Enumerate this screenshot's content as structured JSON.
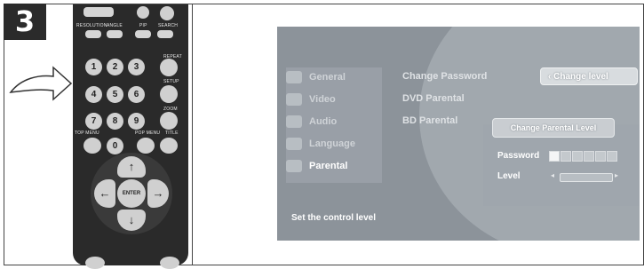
{
  "step": {
    "number": "3"
  },
  "remote": {
    "labels": {
      "resolution": "RESOLUTION",
      "angle": "ANGLE",
      "pip": "PIP",
      "search": "SEARCH",
      "repeat": "REPEAT",
      "setup": "SETUP",
      "zoom": "ZOOM",
      "top_menu": "TOP MENU",
      "pop_menu": "POP MENU",
      "title": "TITLE",
      "enter": "ENTER"
    },
    "numbers": [
      "1",
      "2",
      "3",
      "4",
      "5",
      "6",
      "7",
      "8",
      "9",
      "0"
    ],
    "arrows": {
      "up": "↑",
      "down": "↓",
      "left": "←",
      "right": "→"
    }
  },
  "screen": {
    "menu": [
      "General",
      "Video",
      "Audio",
      "Language",
      "Parental"
    ],
    "active_menu": "Parental",
    "submenu": [
      "Change Password",
      "DVD Parental",
      "BD Parental"
    ],
    "change_level_button": "Change level",
    "change_parental_level_button": "Change Parental Level",
    "password_label": "Password",
    "level_label": "Level",
    "status_text": "Set the control level"
  }
}
